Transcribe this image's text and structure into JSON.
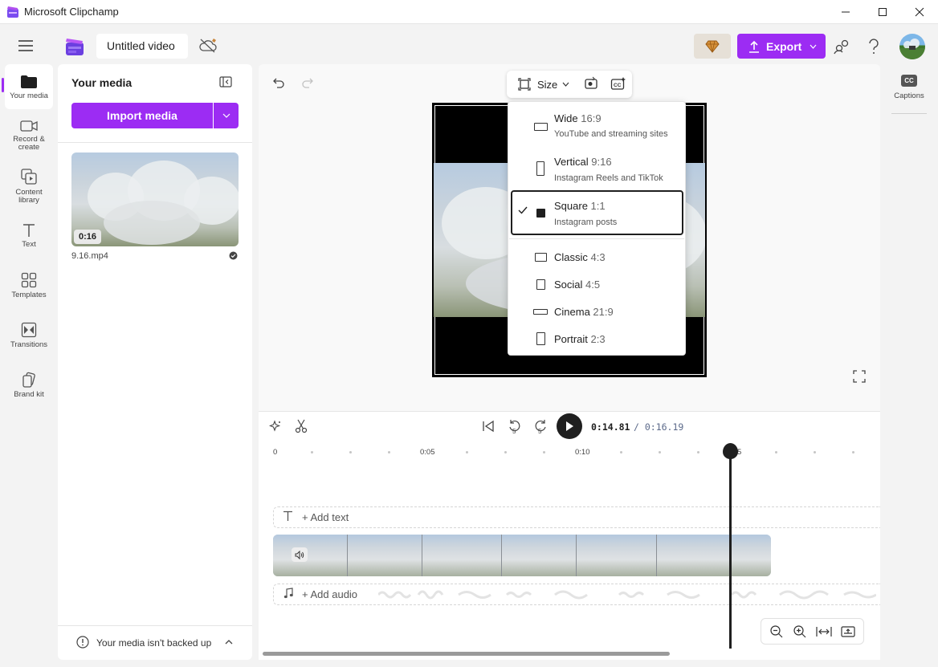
{
  "window": {
    "title": "Microsoft Clipchamp"
  },
  "header": {
    "project_title": "Untitled video",
    "export_label": "Export"
  },
  "rail": {
    "items": [
      {
        "label": "Your media"
      },
      {
        "label": "Record &\ncreate"
      },
      {
        "label": "Content\nlibrary"
      },
      {
        "label": "Text"
      },
      {
        "label": "Templates"
      },
      {
        "label": "Transitions"
      },
      {
        "label": "Brand kit"
      }
    ]
  },
  "media_panel": {
    "title": "Your media",
    "import_label": "Import media",
    "items": [
      {
        "duration": "0:16",
        "filename": "9.16.mp4"
      }
    ],
    "backup_notice": "Your media isn't backed up"
  },
  "preview": {
    "size_label": "Size",
    "size_options": [
      {
        "name": "Wide",
        "ratio": "16:9",
        "desc": "YouTube and streaming sites",
        "selected": false
      },
      {
        "name": "Vertical",
        "ratio": "9:16",
        "desc": "Instagram Reels and TikTok",
        "selected": false
      },
      {
        "name": "Square",
        "ratio": "1:1",
        "desc": "Instagram posts",
        "selected": true
      },
      {
        "name": "Classic",
        "ratio": "4:3",
        "desc": "",
        "selected": false
      },
      {
        "name": "Social",
        "ratio": "4:5",
        "desc": "",
        "selected": false
      },
      {
        "name": "Cinema",
        "ratio": "21:9",
        "desc": "",
        "selected": false
      },
      {
        "name": "Portrait",
        "ratio": "2:3",
        "desc": "",
        "selected": false
      }
    ]
  },
  "playback": {
    "current_time": "0:14.81",
    "total_time": "/ 0:16.19",
    "skip_seconds": "5"
  },
  "timeline": {
    "ticks": [
      "0",
      "0:05",
      "0:10",
      "5"
    ],
    "add_text": "+ Add text",
    "add_audio": "+ Add audio"
  },
  "captions": {
    "label": "Captions",
    "badge": "CC"
  },
  "colors": {
    "accent": "#9c2cf3",
    "premium": "#e6e0d7"
  }
}
